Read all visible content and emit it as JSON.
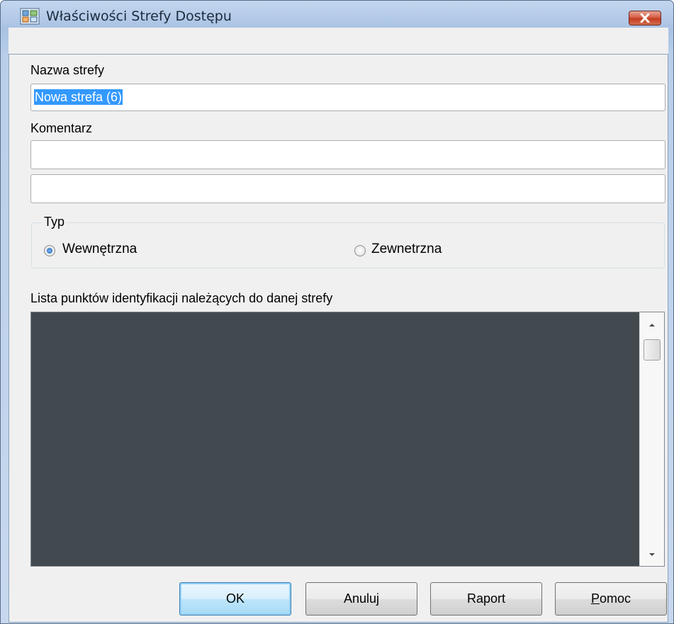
{
  "window": {
    "title": "Właściwości Strefy Dostępu"
  },
  "form": {
    "zone_name_label": "Nazwa strefy",
    "zone_name_value": "Nowa strefa (6)",
    "comment_label": "Komentarz",
    "comment_line1": "",
    "comment_line2": ""
  },
  "type_group": {
    "label": "Typ",
    "options": [
      {
        "label": "Wewnętrzna",
        "selected": true
      },
      {
        "label": "Zewnetrzna",
        "selected": false
      }
    ]
  },
  "points_list": {
    "label": "Lista punktów identyfikacji należących do danej strefy",
    "items": []
  },
  "buttons": {
    "ok": "OK",
    "cancel": "Anuluj",
    "report": "Raport",
    "help_underlined": "P",
    "help_rest": "omoc"
  },
  "colors": {
    "list_background": "#424a50",
    "selection": "#3399ff"
  }
}
